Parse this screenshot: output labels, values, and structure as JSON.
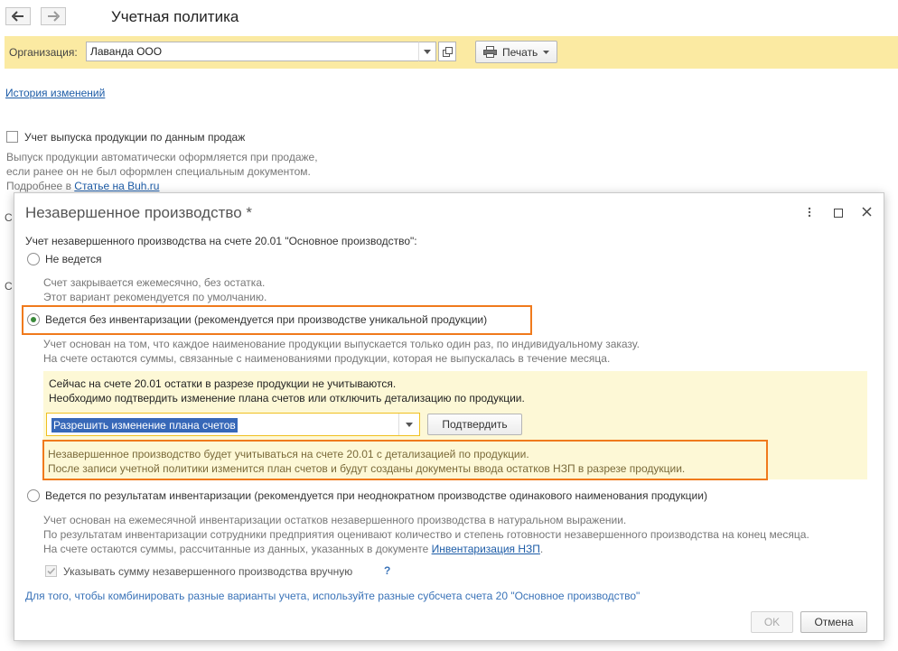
{
  "window": {
    "title": "Учетная политика"
  },
  "org_bar": {
    "label": "Организация:",
    "value": "Лаванда ООО",
    "print_label": "Печать"
  },
  "background": {
    "history_link": "История изменений",
    "checkbox_label": "Учет выпуска продукции по данным продаж",
    "desc_line1": "Выпуск продукции автоматически оформляется при продаже,",
    "desc_line2": "если ранее он не был оформлен специальным документом.",
    "more_prefix": "Подробнее в ",
    "more_link": "Статье на Buh.ru",
    "fragment_1": "С",
    "fragment_2": "С"
  },
  "dialog": {
    "title": "Незавершенное производство *",
    "question": "Учет незавершенного производства на счете 20.01 \"Основное производство\":",
    "options": [
      {
        "label": "Не ведется",
        "hint_line1": "Счет закрывается ежемесячно, без остатка.",
        "hint_line2": "Этот вариант рекомендуется по умолчанию."
      },
      {
        "label": "Ведется без инвентаризации (рекомендуется при производстве уникальной продукции)",
        "hint_line1": "Учет основан на том, что каждое наименование продукции выпускается только один раз, по индивидуальному заказу.",
        "hint_line2": "На счете остаются суммы, связанные с наименованиями продукции, которая не выпускалась в течение месяца."
      },
      {
        "label": "Ведется по результатам инвентаризации (рекомендуется при неоднократном производстве одинакового наименования продукции)",
        "hint_line1": "Учет основан на ежемесячной инвентаризации остатков незавершенного производства в натуральном выражении.",
        "hint_line2": "По результатам инвентаризации сотрудники предприятия оценивают количество и степень готовности незавершенного производства на конец месяца.",
        "hint_line3_prefix": "На счете остаются суммы, рассчитанные из данных, указанных в документе ",
        "hint_line3_link": "Инвентаризация НЗП",
        "hint_line3_suffix": "."
      }
    ],
    "warning": {
      "line1": "Сейчас на счете 20.01 остатки в разрезе продукции не учитываются.",
      "line2": "Необходимо подтвердить изменение плана счетов или отключить детализацию по продукции.",
      "combo_value": "Разрешить изменение плана счетов",
      "confirm_label": "Подтвердить",
      "result_line1": "Незавершенное производство будет учитываться на счете 20.01 с детализацией по продукции.",
      "result_line2": "После записи учетной политики изменится план счетов и будут созданы документы ввода остатков НЗП в разрезе продукции."
    },
    "manual_checkbox": "Указывать сумму незавершенного производства вручную",
    "help_mark": "?",
    "footer_hint": "Для того, чтобы комбинировать разные варианты учета, используйте разные субсчета счета 20 \"Основное производство\"",
    "ok_label": "OK",
    "cancel_label": "Отмена"
  }
}
